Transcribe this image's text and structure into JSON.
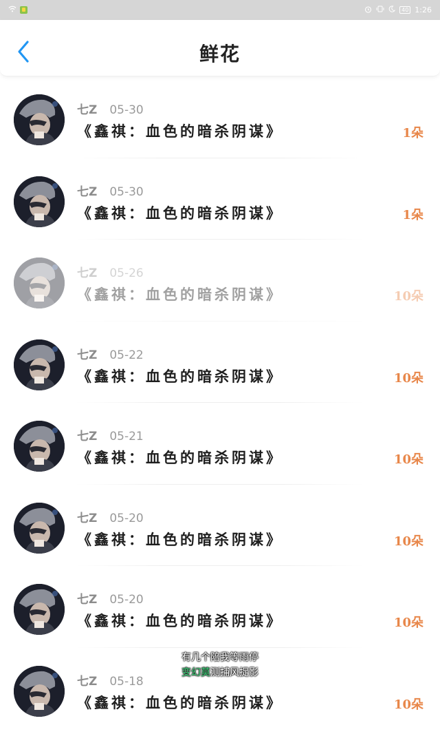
{
  "status_bar": {
    "battery": "40",
    "time": "1:26",
    "icons": [
      "wifi-icon",
      "app-icon",
      "alarm-icon",
      "vibrate-icon",
      "moon-icon",
      "battery-icon"
    ]
  },
  "header": {
    "title": "鲜花",
    "back_icon": "chevron-left-icon",
    "accent_color": "#2196f3"
  },
  "records": [
    {
      "user": "七Z",
      "date": "05-30",
      "book": "《鑫祺：血色的暗杀阴谋》",
      "count": "1朵"
    },
    {
      "user": "七Z",
      "date": "05-30",
      "book": "《鑫祺：血色的暗杀阴谋》",
      "count": "1朵"
    },
    {
      "user": "七Z",
      "date": "05-26",
      "book": "《鑫祺：血色的暗杀阴谋》",
      "count": "10朵"
    },
    {
      "user": "七Z",
      "date": "05-22",
      "book": "《鑫祺：血色的暗杀阴谋》",
      "count": "10朵"
    },
    {
      "user": "七Z",
      "date": "05-21",
      "book": "《鑫祺：血色的暗杀阴谋》",
      "count": "10朵"
    },
    {
      "user": "七Z",
      "date": "05-20",
      "book": "《鑫祺：血色的暗杀阴谋》",
      "count": "10朵"
    },
    {
      "user": "七Z",
      "date": "05-20",
      "book": "《鑫祺：血色的暗杀阴谋》",
      "count": "10朵"
    },
    {
      "user": "七Z",
      "date": "05-18",
      "book": "《鑫祺：血色的暗杀阴谋》",
      "count": "10朵"
    }
  ],
  "caption": {
    "line1": "有几个陪我等雨停",
    "line2_highlight": "变幻莫",
    "line2_rest": "测捕风捉影"
  },
  "colors": {
    "count": "#e8874a",
    "meta": "#9a9a9a",
    "book": "#1e1e1e"
  }
}
